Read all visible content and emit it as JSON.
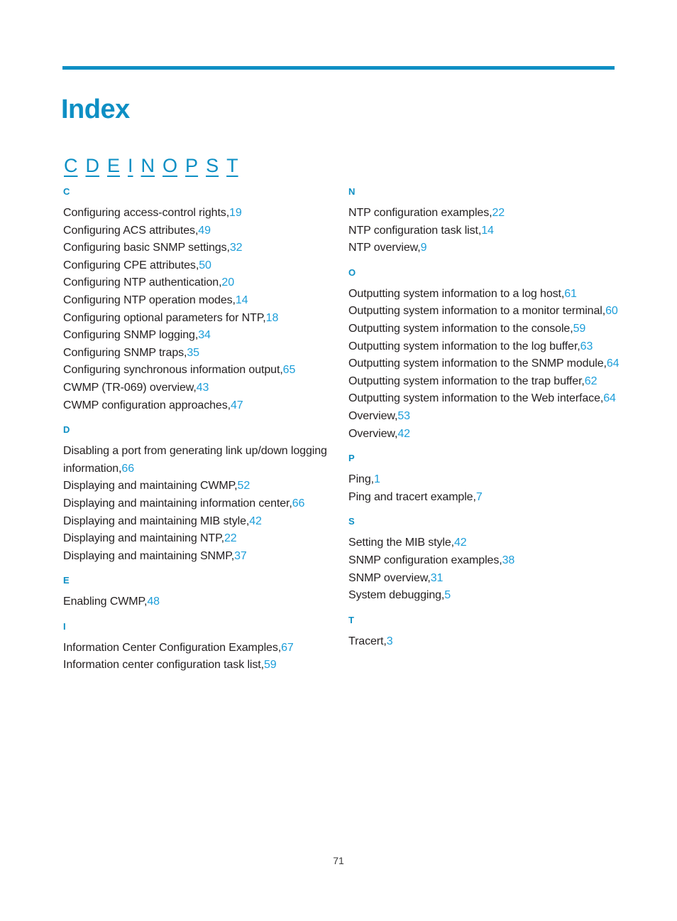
{
  "header": {
    "title": "Index",
    "rule_color": "#0d8fc4"
  },
  "alpha_nav": {
    "letters": [
      "C",
      "D",
      "E",
      "I",
      "N",
      "O",
      "P",
      "S",
      "T"
    ]
  },
  "footer": {
    "page_number": "71"
  },
  "colors": {
    "accent": "#0d8fc4",
    "page_number_link": "#1b9dd9",
    "body_text": "#231f20"
  },
  "columns": [
    {
      "name": "left",
      "sections": [
        {
          "letter": "C",
          "entries": [
            {
              "text": "Configuring access-control rights,",
              "page": "19"
            },
            {
              "text": "Configuring ACS attributes,",
              "page": "49"
            },
            {
              "text": "Configuring basic SNMP settings,",
              "page": "32"
            },
            {
              "text": "Configuring CPE attributes,",
              "page": "50"
            },
            {
              "text": "Configuring NTP authentication,",
              "page": "20"
            },
            {
              "text": "Configuring NTP operation modes,",
              "page": "14"
            },
            {
              "text": "Configuring optional parameters for NTP,",
              "page": "18"
            },
            {
              "text": "Configuring SNMP logging,",
              "page": "34"
            },
            {
              "text": "Configuring SNMP traps,",
              "page": "35"
            },
            {
              "text": "Configuring synchronous information output,",
              "page": "65"
            },
            {
              "text": "CWMP (TR-069) overview,",
              "page": "43"
            },
            {
              "text": "CWMP configuration approaches,",
              "page": "47"
            }
          ]
        },
        {
          "letter": "D",
          "entries": [
            {
              "text": "Disabling a port from generating link up/down logging information,",
              "page": "66"
            },
            {
              "text": "Displaying and maintaining CWMP,",
              "page": "52"
            },
            {
              "text": "Displaying and maintaining information center,",
              "page": "66"
            },
            {
              "text": "Displaying and maintaining MIB style,",
              "page": "42"
            },
            {
              "text": "Displaying and maintaining NTP,",
              "page": "22"
            },
            {
              "text": "Displaying and maintaining SNMP,",
              "page": "37"
            }
          ]
        },
        {
          "letter": "E",
          "entries": [
            {
              "text": "Enabling CWMP,",
              "page": "48"
            }
          ]
        },
        {
          "letter": "I",
          "entries": [
            {
              "text": "Information Center Configuration Examples,",
              "page": "67"
            },
            {
              "text": "Information center configuration task list,",
              "page": "59"
            }
          ]
        }
      ]
    },
    {
      "name": "right",
      "sections": [
        {
          "letter": "N",
          "entries": [
            {
              "text": "NTP configuration examples,",
              "page": "22"
            },
            {
              "text": "NTP configuration task list,",
              "page": "14"
            },
            {
              "text": "NTP overview,",
              "page": "9"
            }
          ]
        },
        {
          "letter": "O",
          "entries": [
            {
              "text": "Outputting system information to a log host,",
              "page": "61"
            },
            {
              "text": "Outputting system information to a monitor terminal,",
              "page": "60"
            },
            {
              "text": "Outputting system information to the console,",
              "page": "59"
            },
            {
              "text": "Outputting system information to the log buffer,",
              "page": "63"
            },
            {
              "text": "Outputting system information to the SNMP module,",
              "page": "64"
            },
            {
              "text": "Outputting system information to the trap buffer,",
              "page": "62"
            },
            {
              "text": "Outputting system information to the Web interface,",
              "page": "64"
            },
            {
              "text": "Overview,",
              "page": "53"
            },
            {
              "text": "Overview,",
              "page": "42"
            }
          ]
        },
        {
          "letter": "P",
          "entries": [
            {
              "text": "Ping,",
              "page": "1"
            },
            {
              "text": "Ping and tracert example,",
              "page": "7"
            }
          ]
        },
        {
          "letter": "S",
          "entries": [
            {
              "text": "Setting the MIB style,",
              "page": "42"
            },
            {
              "text": "SNMP configuration examples,",
              "page": "38"
            },
            {
              "text": "SNMP overview,",
              "page": "31"
            },
            {
              "text": "System debugging,",
              "page": "5"
            }
          ]
        },
        {
          "letter": "T",
          "entries": [
            {
              "text": "Tracert,",
              "page": "3"
            }
          ]
        }
      ]
    }
  ]
}
